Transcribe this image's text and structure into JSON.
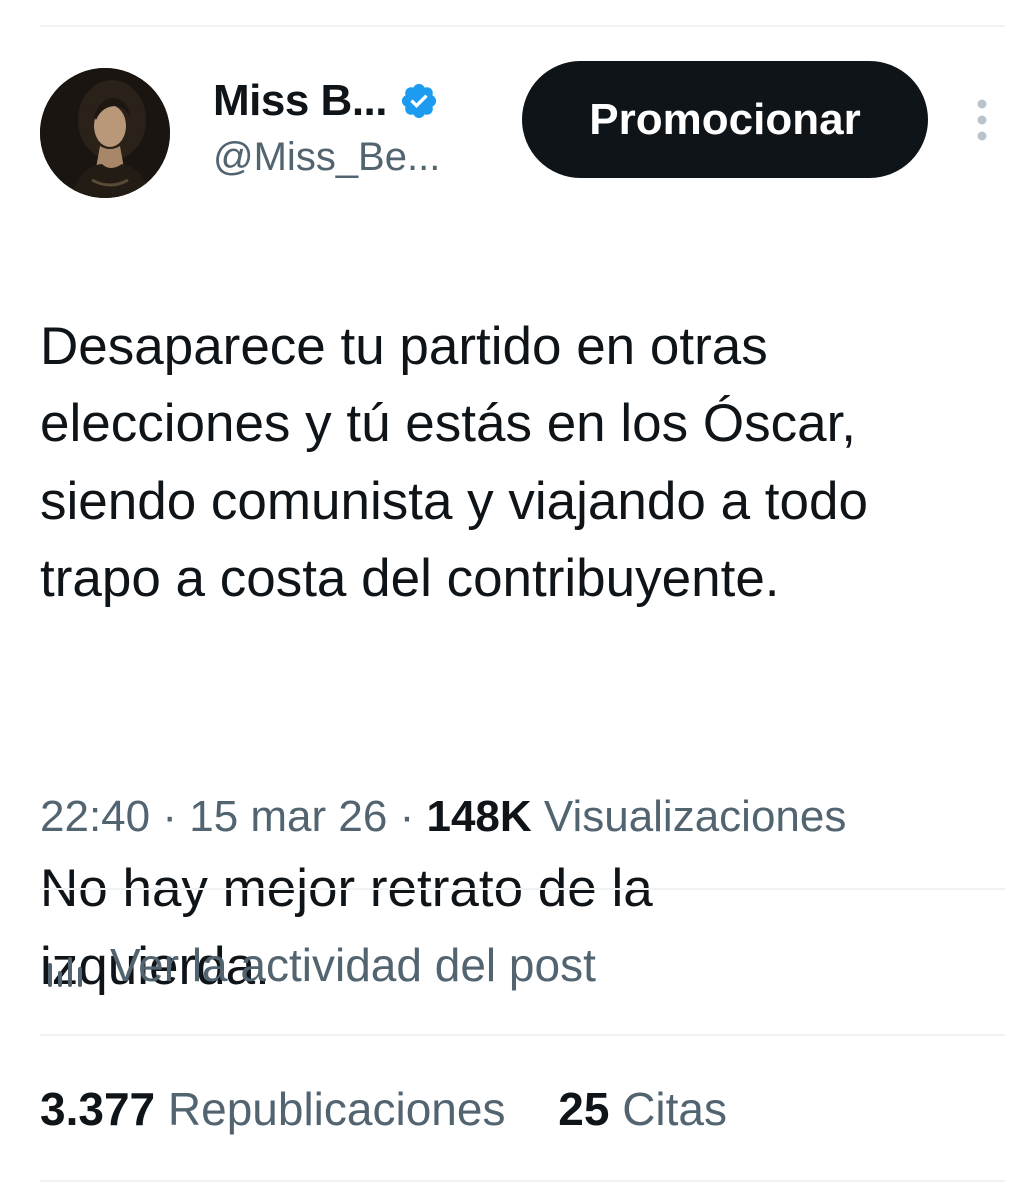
{
  "author": {
    "display_name": "Miss B...",
    "handle": "@Miss_Be...",
    "verified": true,
    "avatar_icon": "avatar-photo"
  },
  "actions": {
    "promote_label": "Promocionar",
    "more_icon": "more-vertical-icon"
  },
  "tweet": {
    "paragraph_1": "Desaparece tu partido en otras\nelecciones y tú estás en los Óscar,\nsiendo comunista y viajando a todo\ntrapo a costa del contribuyente.",
    "paragraph_2": "No hay mejor retrato de la\nizquierda."
  },
  "meta": {
    "time": "22:40",
    "separator": "·",
    "date": "15 mar 26",
    "views_count": "148K",
    "views_label": "Visualizaciones"
  },
  "activity": {
    "icon": "analytics-icon",
    "label": "Ver la actividad del post"
  },
  "stats": {
    "reposts_count": "3.377",
    "reposts_label": "Republicaciones",
    "quotes_count": "25",
    "quotes_label": "Citas"
  },
  "colors": {
    "text_primary": "#0f1419",
    "text_secondary": "#536471",
    "verified_blue": "#1d9bf0",
    "button_bg": "#0f1419",
    "divider": "#eff3f4"
  }
}
